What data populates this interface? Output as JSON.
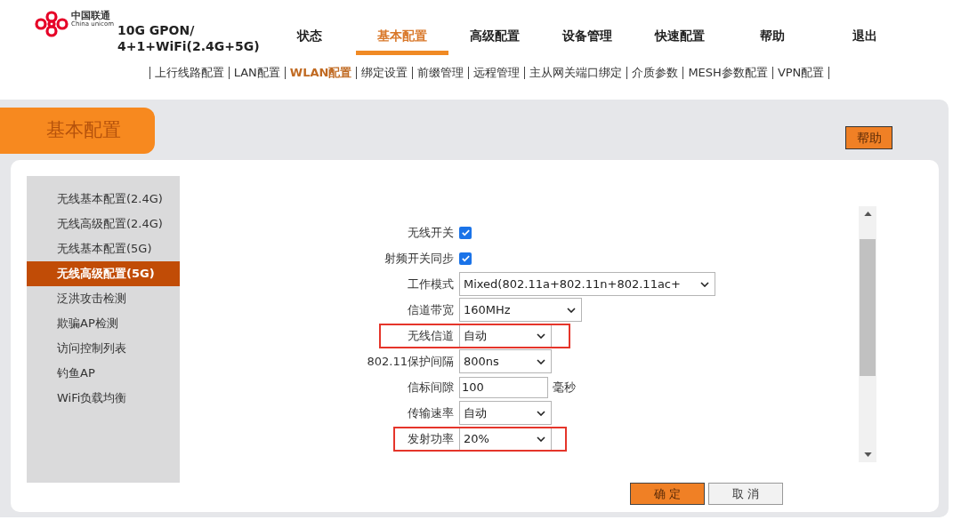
{
  "brand": {
    "name_cn": "中国联通",
    "name_en": "China unicom",
    "model_lines": [
      "10G GPON/",
      "4+1+WiFi(2.4G+5G)"
    ]
  },
  "nav": [
    {
      "label": "状态",
      "selected": false
    },
    {
      "label": "基本配置",
      "selected": true
    },
    {
      "label": "高级配置",
      "selected": false
    },
    {
      "label": "设备管理",
      "selected": false
    },
    {
      "label": "快速配置",
      "selected": false
    },
    {
      "label": "帮助",
      "selected": false
    },
    {
      "label": "退出",
      "selected": false
    }
  ],
  "subnav": [
    {
      "label": "上行线路配置",
      "selected": false
    },
    {
      "label": "LAN配置",
      "selected": false
    },
    {
      "label": "WLAN配置",
      "selected": true
    },
    {
      "label": "绑定设置",
      "selected": false
    },
    {
      "label": "前缀管理",
      "selected": false
    },
    {
      "label": "远程管理",
      "selected": false
    },
    {
      "label": "主从网关端口绑定",
      "selected": false
    },
    {
      "label": "介质参数",
      "selected": false
    },
    {
      "label": "MESH参数配置",
      "selected": false
    },
    {
      "label": "VPN配置",
      "selected": false
    }
  ],
  "section_title": "基本配置",
  "help_button": "帮助",
  "sidebar": {
    "items": [
      {
        "label": "无线基本配置(2.4G)",
        "selected": false
      },
      {
        "label": "无线高级配置(2.4G)",
        "selected": false
      },
      {
        "label": "无线基本配置(5G)",
        "selected": false
      },
      {
        "label": "无线高级配置(5G)",
        "selected": true
      },
      {
        "label": "泛洪攻击检测",
        "selected": false
      },
      {
        "label": "欺骗AP检测",
        "selected": false
      },
      {
        "label": "访问控制列表",
        "selected": false
      },
      {
        "label": "钓鱼AP",
        "selected": false
      },
      {
        "label": "WiFi负载均衡",
        "selected": false
      }
    ]
  },
  "form": [
    {
      "kind": "checkbox",
      "label": "无线开关",
      "checked": true,
      "highlighted": false
    },
    {
      "kind": "checkbox",
      "label": "射频开关同步",
      "checked": true,
      "highlighted": false
    },
    {
      "kind": "select",
      "label": "工作模式",
      "value": "Mixed(802.11a+802.11n+802.11ac+",
      "highlighted": false
    },
    {
      "kind": "select",
      "label": "信道带宽",
      "value": "160MHz",
      "highlighted": false
    },
    {
      "kind": "select",
      "label": "无线信道",
      "value": "自动",
      "highlighted": true
    },
    {
      "kind": "select",
      "label": "802.11保护间隔",
      "value": "800ns",
      "highlighted": false
    },
    {
      "kind": "text",
      "label": "信标间隙",
      "value": "100",
      "unit": "毫秒",
      "highlighted": false
    },
    {
      "kind": "select",
      "label": "传输速率",
      "value": "自动",
      "highlighted": false
    },
    {
      "kind": "select",
      "label": "发射功率",
      "value": "20%",
      "highlighted": true
    }
  ],
  "buttons": [
    {
      "label": "确 定",
      "kind": "primary"
    },
    {
      "label": "取 消",
      "kind": "secondary"
    }
  ]
}
